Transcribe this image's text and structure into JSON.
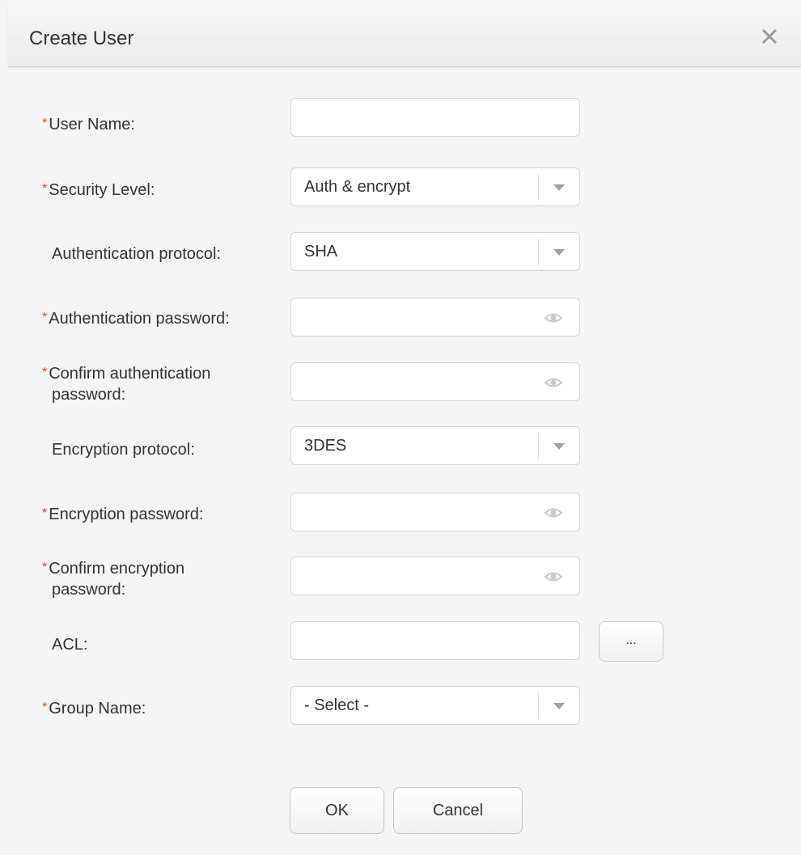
{
  "dialog": {
    "title": "Create User",
    "close_icon": "close-icon"
  },
  "form": {
    "user_name": {
      "label": "User Name:",
      "required": true,
      "value": ""
    },
    "security_level": {
      "label": "Security Level:",
      "required": true,
      "value": "Auth & encrypt"
    },
    "auth_protocol": {
      "label": "Authentication protocol:",
      "required": false,
      "value": "SHA"
    },
    "auth_password": {
      "label": "Authentication password:",
      "required": true,
      "value": ""
    },
    "confirm_auth_password": {
      "label_line1": "Confirm authentication",
      "label_line2": "password:",
      "required": true,
      "value": ""
    },
    "enc_protocol": {
      "label": "Encryption protocol:",
      "required": false,
      "value": "3DES"
    },
    "enc_password": {
      "label": "Encryption password:",
      "required": true,
      "value": ""
    },
    "confirm_enc_password": {
      "label_line1": "Confirm encryption",
      "label_line2": "password:",
      "required": true,
      "value": ""
    },
    "acl": {
      "label": "ACL:",
      "required": false,
      "value": "",
      "browse_label": "..."
    },
    "group_name": {
      "label": "Group Name:",
      "required": true,
      "value": "- Select -"
    }
  },
  "buttons": {
    "ok": "OK",
    "cancel": "Cancel"
  },
  "colors": {
    "required_star": "#e23c2f",
    "field_border": "#d3d3d3",
    "background": "#f5f5f5"
  }
}
